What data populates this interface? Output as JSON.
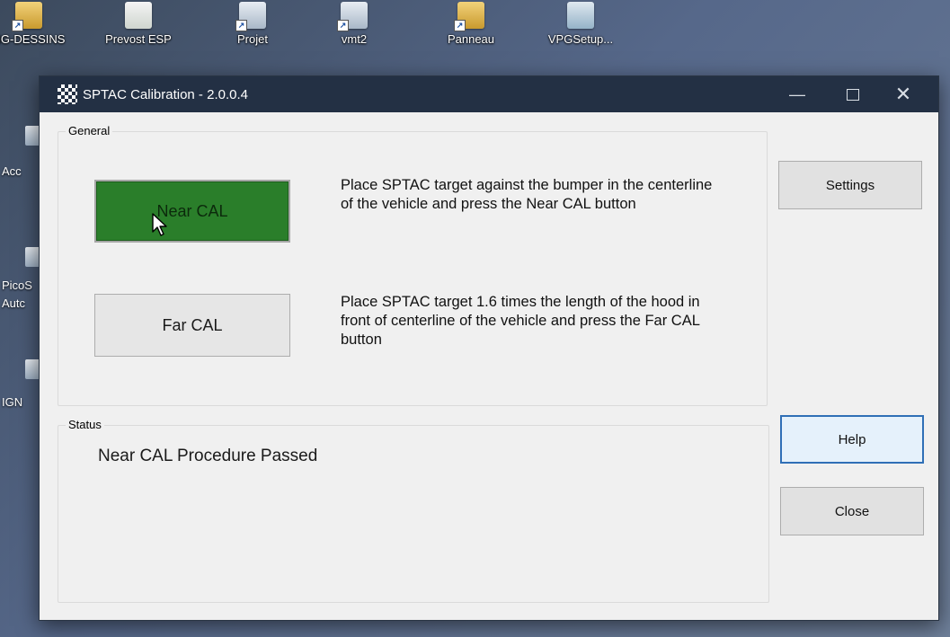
{
  "desktop": {
    "top_icons": [
      {
        "label": "NG-DESSINS",
        "icon": "folder-shortcut-icon"
      },
      {
        "label": "Prevost ESP",
        "icon": "spreadsheet-icon"
      },
      {
        "label": "Projet",
        "icon": "shortcut-icon"
      },
      {
        "label": "vmt2",
        "icon": "shortcut-icon"
      },
      {
        "label": "Panneau",
        "icon": "shortcut-icon"
      },
      {
        "label": "VPGSetup...",
        "icon": "setup-icon"
      }
    ],
    "left_labels": [
      "Acc",
      "PicoS",
      "Autc",
      "IGN"
    ]
  },
  "window": {
    "title": "SPTAC Calibration - 2.0.0.4",
    "controls": {
      "minimize": "—",
      "close": "✕"
    }
  },
  "general": {
    "legend": "General",
    "near_button": "Near CAL",
    "near_instruction": "Place SPTAC target against the bumper in the centerline of the vehicle and press the Near CAL button",
    "far_button": "Far CAL",
    "far_instruction": "Place SPTAC target 1.6 times the length of the hood in front of centerline of the vehicle and press the Far CAL button"
  },
  "status": {
    "legend": "Status",
    "message": "Near CAL Procedure Passed"
  },
  "buttons": {
    "settings": "Settings",
    "help": "Help",
    "close": "Close"
  },
  "colors": {
    "near_cal_active": "#2a7e2a",
    "titlebar": "#233044",
    "help_focus_border": "#2f6fb6"
  }
}
